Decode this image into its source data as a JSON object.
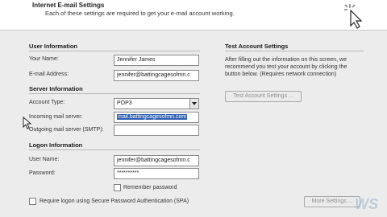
{
  "header": {
    "title": "Internet E-mail Settings",
    "subtitle": "Each of these settings are required to get your e-mail account working."
  },
  "user_info": {
    "title": "User Information",
    "your_name_label": "Your Name:",
    "your_name_value": "Jennifer James",
    "email_label": "E-mail Address:",
    "email_value": "jennifer@battingcagesofmn.c"
  },
  "server_info": {
    "title": "Server Information",
    "account_type_label": "Account Type:",
    "account_type_value": "POP3",
    "incoming_label": "Incoming mail server:",
    "incoming_value": "mail.battingcagesofmn.com",
    "outgoing_label": "Outgoing mail server (SMTP):",
    "outgoing_value": ""
  },
  "logon_info": {
    "title": "Logon Information",
    "username_label": "User Name:",
    "username_value": "jennifer@battingcagesofmn.c",
    "password_label": "Password:",
    "password_value": "**********",
    "remember_label": "Remember password",
    "spa_label": "Require logon using Secure Password Authentication (SPA)"
  },
  "test_settings": {
    "title": "Test Account Settings",
    "description": "After filling out the information on this screen, we recommend you test your account by clicking the button below. (Requires network connection)",
    "test_button": "Test Account Settings ...",
    "more_button": "More Settings ..."
  },
  "watermark": "WS"
}
